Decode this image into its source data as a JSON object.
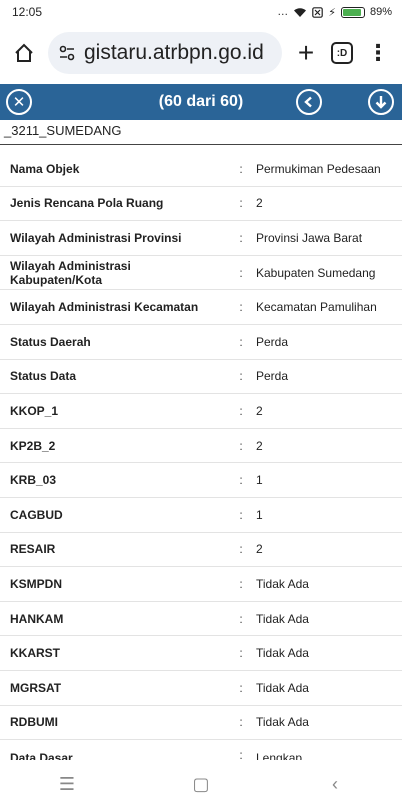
{
  "status_bar": {
    "time": "12:05",
    "battery": "89%",
    "battery_level": 0.89
  },
  "browser": {
    "url": "gistaru.atrbpn.go.id"
  },
  "header": {
    "title": "(60 dari 60)"
  },
  "layer_name": "_3211_SUMEDANG",
  "separator": ":",
  "attributes": [
    {
      "key": "Nama Objek",
      "value": "Permukiman Pedesaan"
    },
    {
      "key": "Jenis Rencana Pola Ruang",
      "value": "2"
    },
    {
      "key": "Wilayah Administrasi Provinsi",
      "value": "Provinsi Jawa Barat"
    },
    {
      "key": "Wilayah Administrasi Kabupaten/Kota",
      "value": "Kabupaten Sumedang"
    },
    {
      "key": "Wilayah Administrasi Kecamatan",
      "value": "Kecamatan Pamulihan"
    },
    {
      "key": "Status Daerah",
      "value": "Perda"
    },
    {
      "key": "Status Data",
      "value": "Perda"
    },
    {
      "key": "KKOP_1",
      "value": "2"
    },
    {
      "key": "KP2B_2",
      "value": "2"
    },
    {
      "key": "KRB_03",
      "value": "1"
    },
    {
      "key": "CAGBUD",
      "value": "1"
    },
    {
      "key": "RESAIR",
      "value": "2"
    },
    {
      "key": "KSMPDN",
      "value": "Tidak Ada"
    },
    {
      "key": "HANKAM",
      "value": "Tidak Ada"
    },
    {
      "key": "KKARST",
      "value": "Tidak Ada"
    },
    {
      "key": "MGRSAT",
      "value": "Tidak Ada"
    },
    {
      "key": "RDBUMI",
      "value": "Tidak Ada"
    }
  ],
  "partial_attribute": {
    "key": "Data Dasar",
    "value": "Lengkap"
  }
}
